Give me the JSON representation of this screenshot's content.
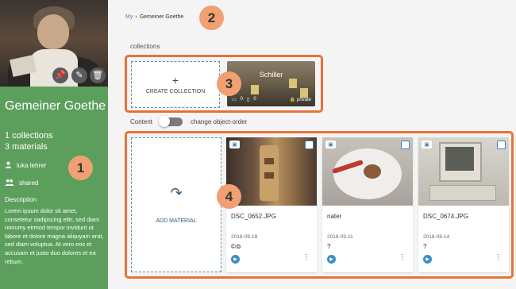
{
  "sidebar": {
    "title": "Gemeiner Goethe",
    "collections_count": "1 collections",
    "materials_count": "3 materials",
    "owner": "luka lehrer",
    "share_state": "shared",
    "description_label": "Description",
    "description": "Lorem ipsum dolor sit amet, consetetur sadipscing elitr, sed diam nonumy eirmod tempor invidunt ut labore et dolore magna aliquyam erat, sed diam voluptua. At vero eos et accusam et justo duo dolores et ea rebum.",
    "actions": [
      "pin-icon",
      "pencil-icon",
      "trash-icon"
    ]
  },
  "breadcrumb": {
    "root": "My",
    "separator": "›",
    "current": "Gemeiner Goethe"
  },
  "collections_section": {
    "label": "collections",
    "create_label": "CREATE COLLECTION",
    "cards": [
      {
        "name": "Schiller",
        "subcollections": "0",
        "materials": "0",
        "privacy": "private"
      }
    ]
  },
  "content_toggle": {
    "label": "Content",
    "toggle_label": "change object-order"
  },
  "materials_section": {
    "add_label": "ADD MATERIAL",
    "items": [
      {
        "title": "DSC_0652.JPG",
        "date": "2018-09-18",
        "license": "©⊜"
      },
      {
        "title": "nater",
        "date": "2018-09-11",
        "license": "?"
      },
      {
        "title": "DSC_0674.JPG",
        "date": "2018-08-14",
        "license": "?"
      }
    ]
  },
  "callouts": [
    "1",
    "2",
    "3",
    "4"
  ],
  "colors": {
    "sidebar": "#5c9f5d",
    "highlight": "#e87236",
    "badge": "#f0a073",
    "accent": "#4a7cc2"
  }
}
